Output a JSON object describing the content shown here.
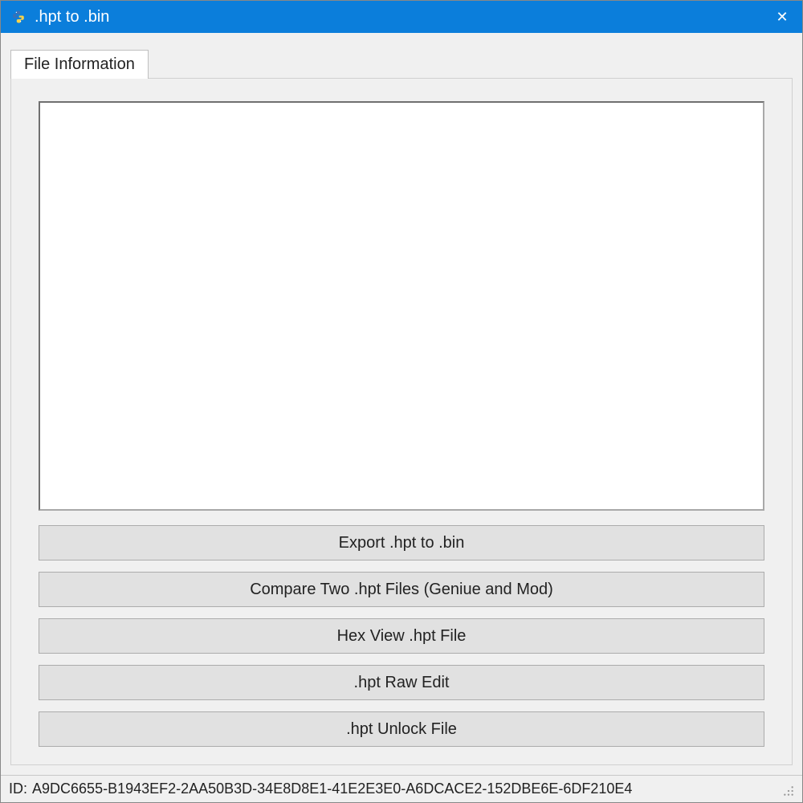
{
  "titlebar": {
    "title": ".hpt to .bin",
    "close_glyph": "✕"
  },
  "tabs": [
    {
      "label": "File Information"
    }
  ],
  "main": {
    "textarea_value": ""
  },
  "buttons": {
    "export": "Export .hpt to .bin",
    "compare": "Compare Two .hpt Files (Geniue and Mod)",
    "hexview": "Hex View .hpt File",
    "rawedit": ".hpt Raw Edit",
    "unlock": ".hpt Unlock File"
  },
  "statusbar": {
    "id_label": "ID:",
    "id_value": "A9DC6655-B1943EF2-2AA50B3D-34E8D8E1-41E2E3E0-A6DCACE2-152DBE6E-6DF210E4"
  },
  "colors": {
    "titlebar_bg": "#0b7edb",
    "button_bg": "#e1e1e1",
    "window_bg": "#f0f0f0"
  }
}
